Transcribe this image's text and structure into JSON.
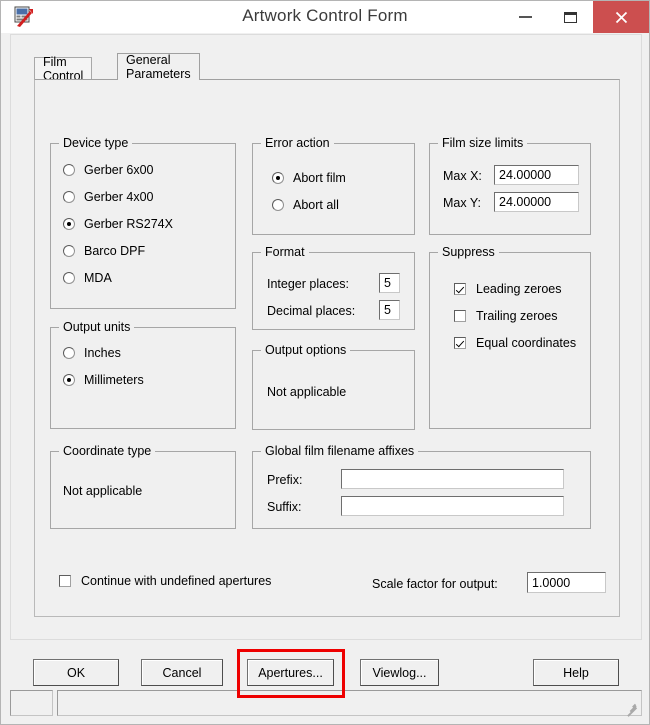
{
  "window": {
    "title": "Artwork Control Form",
    "icon": "artwork-app-icon",
    "minimize_label": "–",
    "maximize_label": "☐",
    "close_label": "×"
  },
  "tabs": [
    {
      "label": "Film Control",
      "active": false
    },
    {
      "label": "General Parameters",
      "active": true
    }
  ],
  "device_type": {
    "title": "Device type",
    "options": [
      {
        "label": "Gerber 6x00",
        "selected": false
      },
      {
        "label": "Gerber 4x00",
        "selected": false
      },
      {
        "label": "Gerber RS274X",
        "selected": true
      },
      {
        "label": "Barco DPF",
        "selected": false
      },
      {
        "label": "MDA",
        "selected": false
      }
    ]
  },
  "output_units": {
    "title": "Output units",
    "options": [
      {
        "label": "Inches",
        "selected": false
      },
      {
        "label": "Millimeters",
        "selected": true
      }
    ]
  },
  "coordinate_type": {
    "title": "Coordinate type",
    "value": "Not applicable"
  },
  "error_action": {
    "title": "Error action",
    "options": [
      {
        "label": "Abort film",
        "selected": true
      },
      {
        "label": "Abort all",
        "selected": false
      }
    ]
  },
  "format": {
    "title": "Format",
    "integer_places_label": "Integer places:",
    "integer_places_value": "5",
    "decimal_places_label": "Decimal places:",
    "decimal_places_value": "5"
  },
  "output_options": {
    "title": "Output options",
    "value": "Not applicable"
  },
  "film_filename_affixes": {
    "title": "Global film filename affixes",
    "prefix_label": "Prefix:",
    "prefix_value": "",
    "prefix_placeholder": "",
    "suffix_label": "Suffix:",
    "suffix_value": "",
    "suffix_placeholder": ""
  },
  "film_size_limits": {
    "title": "Film size limits",
    "max_x_label": "Max X:",
    "max_x_value": "24.00000",
    "max_y_label": "Max Y:",
    "max_y_value": "24.00000"
  },
  "suppress": {
    "title": "Suppress",
    "options": [
      {
        "label": "Leading zeroes",
        "checked": true
      },
      {
        "label": "Trailing zeroes",
        "checked": false
      },
      {
        "label": "Equal coordinates",
        "checked": true
      }
    ]
  },
  "bottom": {
    "continue_undefined_label": "Continue with undefined apertures",
    "continue_undefined_checked": false,
    "scale_factor_label": "Scale factor for output:",
    "scale_factor_value": "1.0000"
  },
  "buttons": [
    {
      "label": "OK",
      "name": "ok-button"
    },
    {
      "label": "Cancel",
      "name": "cancel-button"
    },
    {
      "label": "Apertures...",
      "name": "apertures-button",
      "highlighted": true
    },
    {
      "label": "Viewlog...",
      "name": "viewlog-button"
    },
    {
      "label": "Help",
      "name": "help-button"
    }
  ],
  "statusbar": {
    "pane1": "",
    "pane2": ""
  },
  "colors": {
    "close_button": "#cc4f4f",
    "highlight": "#ee0000",
    "face": "#f0f0f0"
  }
}
